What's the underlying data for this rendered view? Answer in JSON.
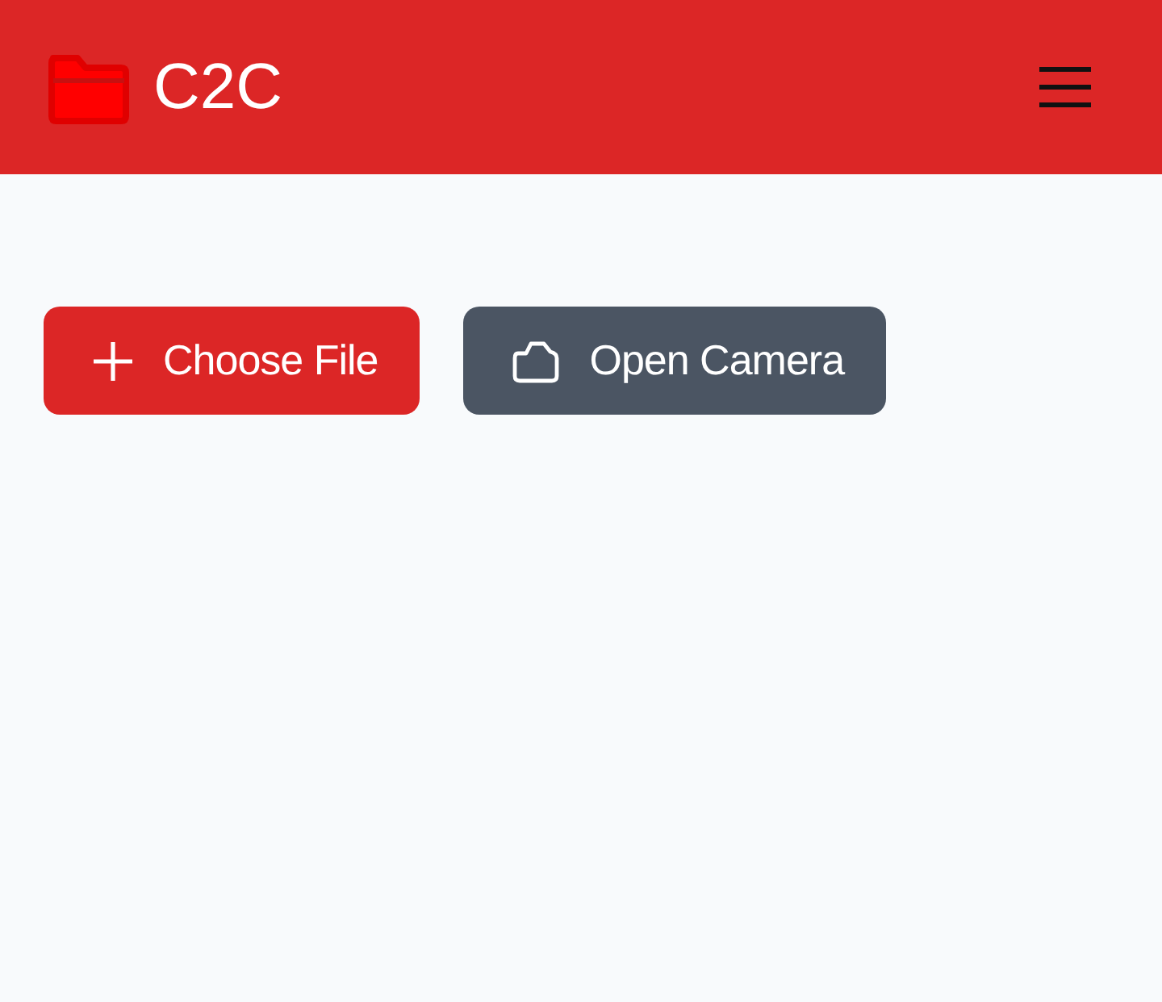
{
  "header": {
    "title": "C2C"
  },
  "buttons": [
    {
      "label": "Choose File",
      "kind": "primary"
    },
    {
      "label": "Open Camera",
      "kind": "secondary"
    }
  ]
}
